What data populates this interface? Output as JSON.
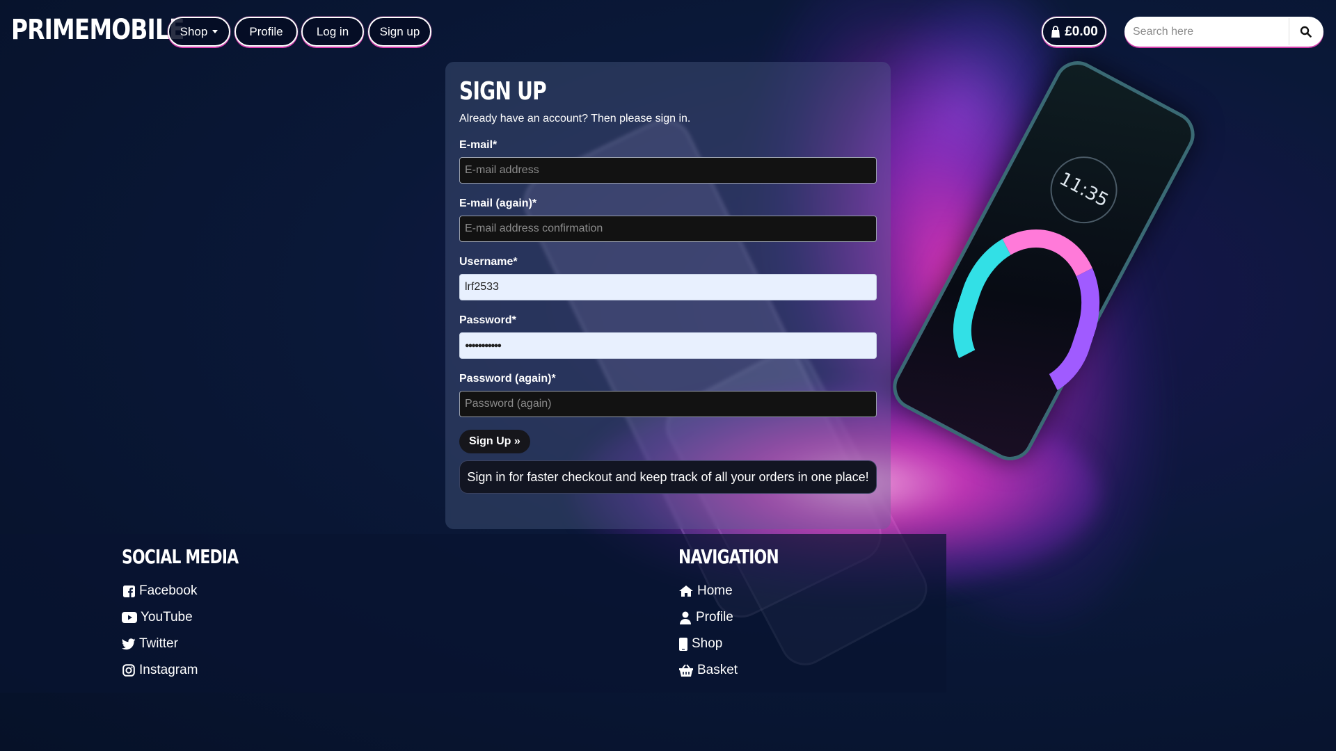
{
  "nav": {
    "brand": "PRIMEMOBILE",
    "shop": "Shop",
    "profile": "Profile",
    "login": "Log in",
    "signup": "Sign up",
    "basket_total": "£0.00",
    "search_placeholder": "Search here"
  },
  "form": {
    "title": "SIGN UP",
    "intro": "Already have an account? Then please sign in.",
    "email_label": "E-mail*",
    "email_placeholder": "E-mail address",
    "email2_label": "E-mail (again)*",
    "email2_placeholder": "E-mail address confirmation",
    "username_label": "Username*",
    "username_value": "lrf2533",
    "password_label": "Password*",
    "password_value": "●●●●●●●●●●●",
    "password2_label": "Password (again)*",
    "password2_placeholder": "Password (again)",
    "submit_label": "Sign Up »",
    "banner": "Sign in for faster checkout and keep track of all your orders in one place!"
  },
  "footer": {
    "social_title": "SOCIAL MEDIA",
    "social": [
      {
        "label": "Facebook",
        "icon": "facebook-icon"
      },
      {
        "label": "YouTube",
        "icon": "youtube-icon"
      },
      {
        "label": "Twitter",
        "icon": "twitter-icon"
      },
      {
        "label": "Instagram",
        "icon": "instagram-icon"
      }
    ],
    "nav_title": "NAVIGATION",
    "nav": [
      {
        "label": "Home",
        "icon": "home-icon"
      },
      {
        "label": "Profile",
        "icon": "user-icon"
      },
      {
        "label": "Shop",
        "icon": "mobile-icon"
      },
      {
        "label": "Basket",
        "icon": "basket-icon"
      }
    ]
  },
  "colors": {
    "accent": "#d63fae",
    "background": "#07142f"
  }
}
